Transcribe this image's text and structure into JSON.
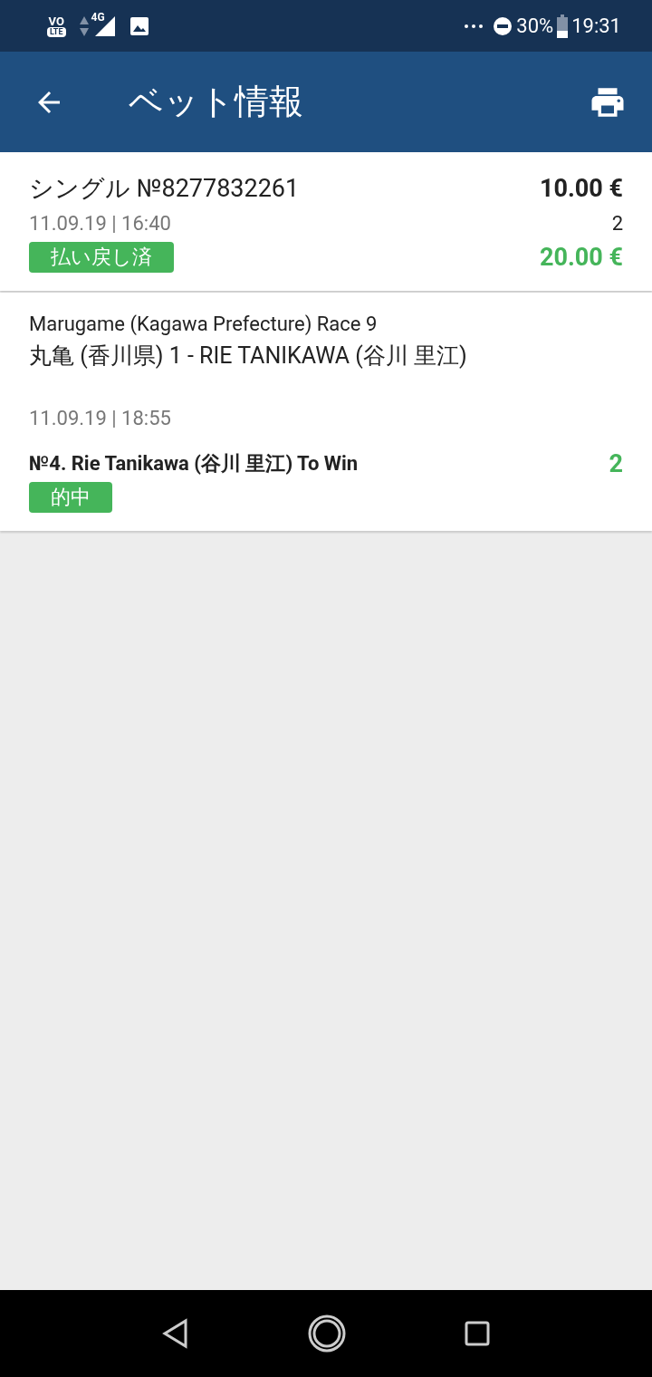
{
  "status_bar": {
    "volte_top": "VO",
    "volte_bottom": "LTE",
    "network": "4G",
    "battery": "30%",
    "time": "19:31"
  },
  "app_bar": {
    "title": "ベット情報"
  },
  "bet": {
    "title": "シングル №8277832261",
    "date": "11.09.19 | 16:40",
    "status": "払い戻し済",
    "stake": "10.00 €",
    "odds": "2",
    "payout": "20.00 €"
  },
  "selections": [
    {
      "event": "Marugame (Kagawa Prefecture) Race 9",
      "market": "丸亀 (香川県) 1 - RIE TANIKAWA (谷川 里江)",
      "date": "11.09.19 | 18:55",
      "pick": "№4. Rie Tanikawa (谷川 里江) To Win",
      "odds": "2",
      "result": "的中"
    }
  ]
}
